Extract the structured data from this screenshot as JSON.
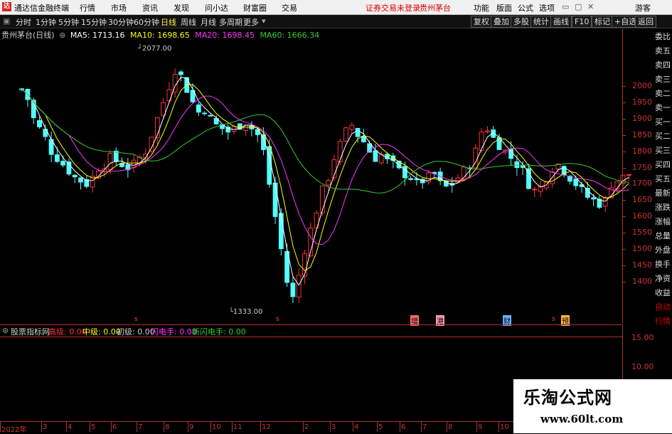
{
  "app": {
    "title": "通达信金融终端",
    "logo": "达"
  },
  "menu": {
    "items": [
      "行情",
      "市场",
      "资讯",
      "发现",
      "问小达",
      "财富圈",
      "交易"
    ],
    "status_login": "证券交易未登录",
    "status_stock": "贵州茅台",
    "right_items": [
      "功能",
      "版面",
      "公式",
      "选项"
    ],
    "user": "游客"
  },
  "toolbar": {
    "periods": [
      "分时",
      "1分钟",
      "5分钟",
      "15分钟",
      "30分钟",
      "60分钟",
      "日线",
      "周线",
      "月线",
      "多周期",
      "更多"
    ],
    "selected": "日线",
    "buttons": [
      "复权",
      "叠加",
      "多股",
      "统计",
      "画线",
      "F10",
      "标记",
      "+自选",
      "返回"
    ]
  },
  "chart_header": {
    "stock": "贵州茅台(日线)",
    "ma5": "MA5: 1713.16",
    "ma10": "MA10: 1698.65",
    "ma20": "MA20: 1698.45",
    "ma60": "MA60: 1666.34"
  },
  "chart_data": {
    "type": "candlestick",
    "ylim": [
      1300,
      2150
    ],
    "y_ticks": [
      "2000",
      "1950",
      "1900",
      "1850",
      "1800",
      "1750",
      "1700",
      "1650",
      "1600",
      "1550",
      "1500",
      "1450",
      "1400"
    ],
    "annotations": {
      "high": "2077.00",
      "low": "1333.00"
    },
    "x_ticks": [
      "2022年",
      "3",
      "4",
      "5",
      "6",
      "7",
      "8",
      "9",
      "10",
      "11",
      "12",
      "2",
      "3",
      "4",
      "5",
      "6",
      "7",
      "8",
      "9",
      "10"
    ],
    "close_series": [
      1990,
      1960,
      1900,
      1870,
      1840,
      1800,
      1780,
      1760,
      1740,
      1720,
      1710,
      1700,
      1720,
      1750,
      1760,
      1780,
      1770,
      1760,
      1750,
      1760,
      1780,
      1800,
      1850,
      1900,
      1950,
      2000,
      2050,
      2030,
      1990,
      1950,
      1920,
      1930,
      1900,
      1880,
      1870,
      1860,
      1870,
      1880,
      1890,
      1870,
      1850,
      1800,
      1700,
      1600,
      1500,
      1400,
      1350,
      1420,
      1500,
      1560,
      1620,
      1680,
      1720,
      1780,
      1820,
      1860,
      1880,
      1850,
      1830,
      1800,
      1780,
      1790,
      1770,
      1760,
      1740,
      1730,
      1720,
      1700,
      1710,
      1720,
      1730,
      1700,
      1690,
      1700,
      1720,
      1740,
      1760,
      1800,
      1860,
      1870,
      1840,
      1820,
      1800,
      1780,
      1760,
      1740,
      1700,
      1680,
      1690,
      1720,
      1750,
      1760,
      1740,
      1720,
      1700,
      1680,
      1660,
      1650,
      1640,
      1650,
      1700,
      1710,
      1720,
      1730
    ],
    "ma_colors": {
      "ma5": "#ffffff",
      "ma10": "#ffff00",
      "ma20": "#ff33ff",
      "ma60": "#33cc33"
    },
    "event_markers": [
      "增",
      "港",
      "财",
      "预"
    ]
  },
  "indicator": {
    "name": "股票指标网",
    "hi": "高级: 0.00",
    "mid": "中级: 0.00",
    "low": "初级: 0.00",
    "flash": "闪电手: 0.00",
    "newflash": "新闪电手: 0.00",
    "y_ticks": [
      "15.00",
      "10.00"
    ]
  },
  "sidebar": [
    "委比",
    "卖五",
    "卖四",
    "卖三",
    "卖二",
    "卖一",
    "买一",
    "买二",
    "买三",
    "买四",
    "买五",
    "最新",
    "涨跌",
    "涨幅",
    "总量",
    "外盘",
    "换手",
    "净资",
    "收益",
    "自动",
    "行情"
  ],
  "watermark": {
    "line1": "乐淘公式网",
    "line2": "www.60lt.com"
  }
}
